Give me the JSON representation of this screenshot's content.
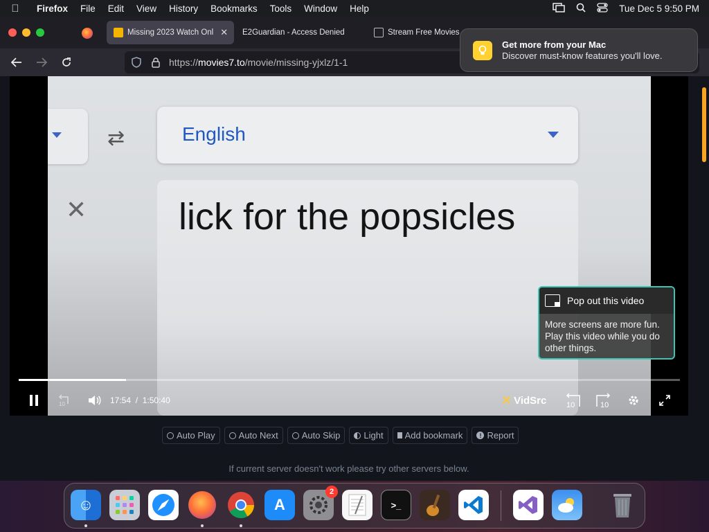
{
  "menubar": {
    "app_name": "Firefox",
    "items": [
      "File",
      "Edit",
      "View",
      "History",
      "Bookmarks",
      "Tools",
      "Window",
      "Help"
    ],
    "clock": "Tue Dec 5  9:50 PM"
  },
  "tabs": [
    {
      "title": "Missing 2023 Watch Onl",
      "active": true
    },
    {
      "title": "E2Guardian - Access Denied",
      "active": false
    },
    {
      "title": "Stream Free Movies",
      "active": false
    }
  ],
  "address_bar": {
    "url_prefix": "https://",
    "url_host": "movies7.to",
    "url_path": "/movie/missing-yjxlz/1-1"
  },
  "notification": {
    "title": "Get more from your Mac",
    "body": "Discover must-know features you'll love."
  },
  "video_frame": {
    "language": "English",
    "caption_text": "lick for the popsicles"
  },
  "player": {
    "current_time": "17:54",
    "separator": "/",
    "duration": "1:50:40",
    "progress_fraction": 0.162,
    "brand": "VidSrc",
    "popout": {
      "title": "Pop out this video",
      "body": "More screens are more fun. Play this video while you do other things."
    }
  },
  "options": [
    "Auto Play",
    "Auto Next",
    "Auto Skip",
    "Light",
    "Add bookmark",
    "Report"
  ],
  "server_note": "If current server doesn't work please try other servers below.",
  "dock": {
    "apps": [
      "finder",
      "launchpad",
      "safari",
      "firefox",
      "chrome",
      "app-store",
      "system-settings",
      "textedit",
      "terminal",
      "garageband",
      "vscode",
      "visual-studio",
      "weather",
      "trash"
    ],
    "settings_badge": "2"
  },
  "colors": {
    "accent_orange": "#f6a623",
    "popout_border": "#3ec4b3",
    "link_blue": "#1f57c3"
  }
}
